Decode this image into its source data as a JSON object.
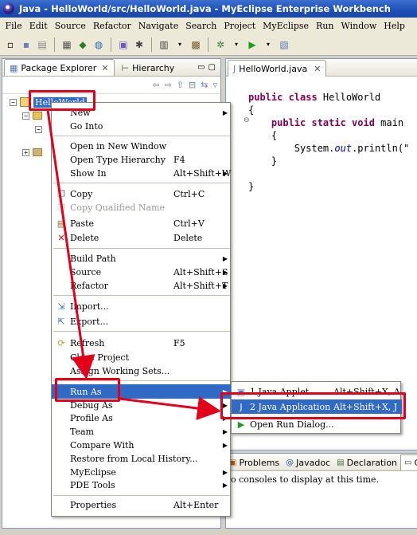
{
  "window": {
    "title": "Java - HelloWorld/src/HelloWorld.java - MyEclipse Enterprise Workbench"
  },
  "menubar": [
    "File",
    "Edit",
    "Source",
    "Refactor",
    "Navigate",
    "Search",
    "Project",
    "MyEclipse",
    "Run",
    "Window",
    "Help"
  ],
  "left_panel": {
    "tabs": {
      "package_explorer": "Package Explorer",
      "hierarchy": "Hierarchy"
    },
    "tree": {
      "project": "HelloWorld"
    }
  },
  "editor": {
    "tab": "HelloWorld.java",
    "code": {
      "kw_public_class": "public class",
      "class_name": " HelloWorld",
      "brace_open": "{",
      "kw_public_static_void": "public static void",
      "main": " main",
      "inner_brace_open": "{",
      "system": "System.",
      "out": "out",
      "println": ".println(\"",
      "inner_brace_close": "}",
      "brace_close": "}"
    }
  },
  "bottom_panel": {
    "tabs": {
      "problems": "Problems",
      "javadoc": "Javadoc",
      "declaration": "Declaration",
      "console": "Co"
    },
    "message": "o consoles to display at this time."
  },
  "context_menu": {
    "new": "New",
    "go_into": "Go Into",
    "open_new_window": "Open in New Window",
    "open_type_hierarchy": "Open Type Hierarchy",
    "open_type_hierarchy_accel": "F4",
    "show_in": "Show In",
    "show_in_accel": "Alt+Shift+W",
    "copy": "Copy",
    "copy_accel": "Ctrl+C",
    "copy_qualified_name": "Copy Qualified Name",
    "paste": "Paste",
    "paste_accel": "Ctrl+V",
    "delete": "Delete",
    "delete_accel": "Delete",
    "build_path": "Build Path",
    "source": "Source",
    "source_accel": "Alt+Shift+S",
    "refactor": "Refactor",
    "refactor_accel": "Alt+Shift+T",
    "import": "Import...",
    "export": "Export...",
    "refresh": "Refresh",
    "refresh_accel": "F5",
    "close_project": "Close Project",
    "assign_working_sets": "Assign Working Sets...",
    "run_as": "Run As",
    "debug_as": "Debug As",
    "profile_as": "Profile As",
    "team": "Team",
    "compare_with": "Compare With",
    "restore_local_history": "Restore from Local History...",
    "myeclipse": "MyEclipse",
    "pde_tools": "PDE Tools",
    "properties": "Properties",
    "properties_accel": "Alt+Enter"
  },
  "submenu": {
    "java_applet": "1 Java Applet",
    "java_applet_accel": "Alt+Shift+X, A",
    "java_application": "2 Java Application",
    "java_application_accel": "Alt+Shift+X, J",
    "open_run_dialog": "Open Run Dialog..."
  },
  "colors": {
    "highlight": "#316ac5",
    "annotation_red": "#e2001a",
    "keyword": "#7f0055",
    "field": "#0000c0"
  }
}
